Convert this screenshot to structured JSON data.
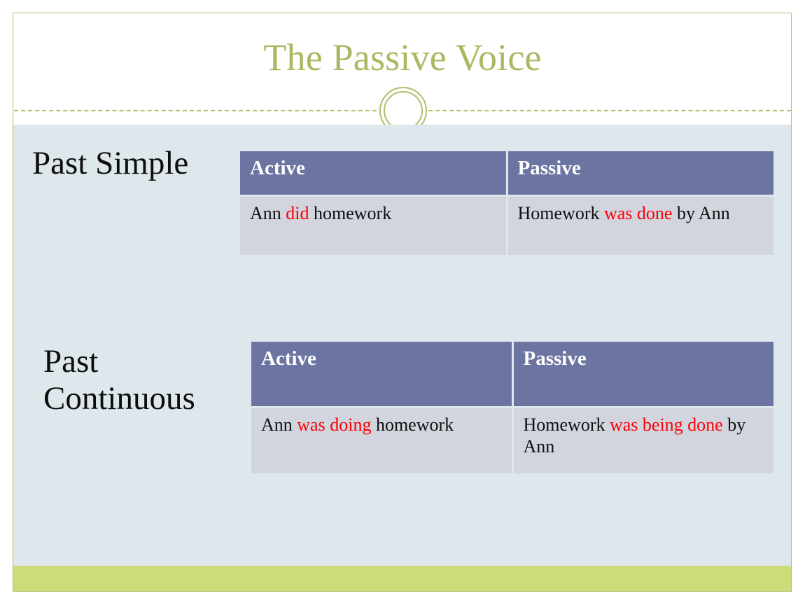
{
  "slide": {
    "title": "The Passive Voice",
    "ornament_icon": "double-circle-ornament",
    "colors": {
      "title": "#adb762",
      "frame_border": "#b3bc6a",
      "header_rule": "#b3bc6a",
      "body_background": "#dee7ec",
      "footer_band": "#cedb79",
      "table_header": "#6c75a1",
      "table_header_text": "#ffffff",
      "table_cell": "#d2d4de",
      "highlight": "#fb0006",
      "body_text": "#101010"
    }
  },
  "sections": [
    {
      "label": "Past Simple",
      "columns": [
        "Active",
        "Passive"
      ],
      "row": {
        "active": {
          "before": "Ann ",
          "highlight": "did",
          "after": " homework"
        },
        "passive": {
          "before": "Homework ",
          "highlight": "was done",
          "after": " by Ann"
        }
      }
    },
    {
      "label": "Past Continuous",
      "columns": [
        "Active",
        "Passive"
      ],
      "row": {
        "active": {
          "before": "Ann ",
          "highlight": "was doing",
          "after": " homework"
        },
        "passive": {
          "before": "Homework ",
          "highlight": "was being done",
          "after": " by Ann"
        }
      }
    }
  ]
}
